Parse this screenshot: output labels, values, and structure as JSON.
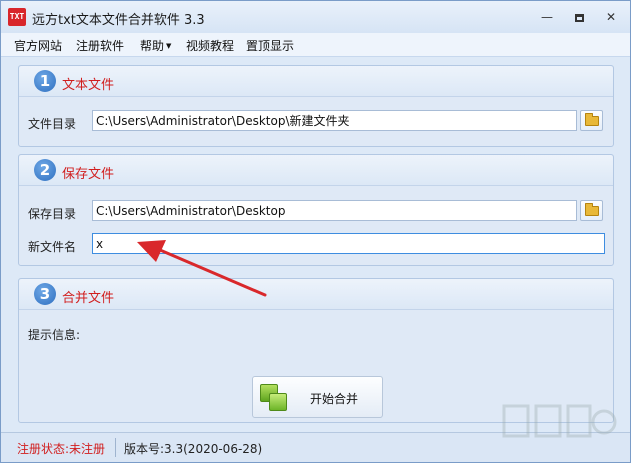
{
  "window": {
    "title": "远方txt文本文件合并软件 3.3",
    "icon_text": "TXT",
    "controls": {
      "minimize": "—",
      "close": "✕"
    }
  },
  "menu": {
    "items": [
      "官方网站",
      "注册软件",
      "帮助",
      "视频教程",
      "置顶显示"
    ]
  },
  "section1": {
    "number": "1",
    "title": "文本文件",
    "dir_label": "文件目录",
    "dir_value": "C:\\Users\\Administrator\\Desktop\\新建文件夹"
  },
  "section2": {
    "number": "2",
    "title": "保存文件",
    "dir_label": "保存目录",
    "dir_value": "C:\\Users\\Administrator\\Desktop",
    "name_label": "新文件名",
    "name_value": "x"
  },
  "section3": {
    "number": "3",
    "title": "合并文件",
    "info_label": "提示信息:",
    "merge_label": "开始合并"
  },
  "status": {
    "registration": "注册状态:未注册",
    "version": "版本号:3.3(2020-06-28)"
  },
  "colors": {
    "accent_red": "#d11e1e",
    "annotation_arrow": "#d9282b",
    "step_blue": "#2e6fc0"
  }
}
